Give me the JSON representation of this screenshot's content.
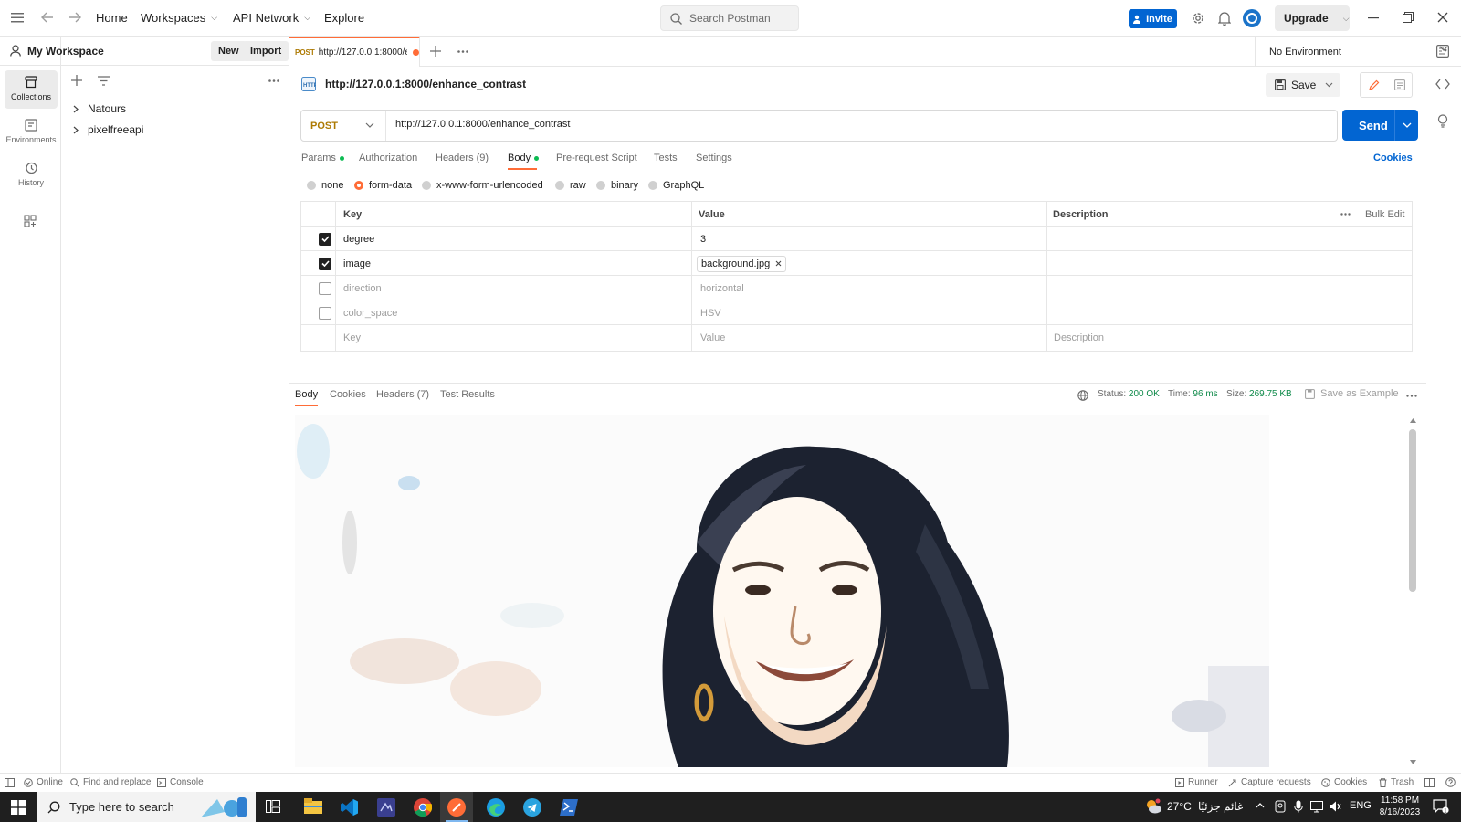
{
  "topbar": {
    "nav": [
      {
        "label": "Home",
        "dropdown": false
      },
      {
        "label": "Workspaces",
        "dropdown": true
      },
      {
        "label": "API Network",
        "dropdown": true
      },
      {
        "label": "Explore",
        "dropdown": false
      }
    ],
    "search_placeholder": "Search Postman",
    "invite_label": "Invite",
    "upgrade_label": "Upgrade"
  },
  "rail": {
    "items": [
      {
        "label": "Collections",
        "icon": "collections-icon",
        "active": true
      },
      {
        "label": "Environments",
        "icon": "environments-icon",
        "active": false
      },
      {
        "label": "History",
        "icon": "history-icon",
        "active": false
      }
    ]
  },
  "sidebar": {
    "workspace_name": "My Workspace",
    "new_label": "New",
    "import_label": "Import",
    "collections": [
      "Natours",
      "pixelfreeapi"
    ]
  },
  "tabs": {
    "active": {
      "method": "POST",
      "title": "http://127.0.0.1:8000/e",
      "unsaved": true
    },
    "environment": "No Environment"
  },
  "request": {
    "title": "http://127.0.0.1:8000/enhance_contrast",
    "save_label": "Save",
    "method": "POST",
    "url": "http://127.0.0.1:8000/enhance_contrast",
    "send_label": "Send",
    "cookies_label": "Cookies",
    "tabs": [
      {
        "label": "Params",
        "dot": true
      },
      {
        "label": "Authorization",
        "dot": false
      },
      {
        "label": "Headers (9)",
        "dot": false
      },
      {
        "label": "Body",
        "dot": true,
        "active": true
      },
      {
        "label": "Pre-request Script",
        "dot": false
      },
      {
        "label": "Tests",
        "dot": false
      },
      {
        "label": "Settings",
        "dot": false
      }
    ],
    "body_types": [
      "none",
      "form-data",
      "x-www-form-urlencoded",
      "raw",
      "binary",
      "GraphQL"
    ],
    "body_type_selected": "form-data"
  },
  "form_table": {
    "headers": {
      "key": "Key",
      "value": "Value",
      "description": "Description",
      "bulk_edit": "Bulk Edit"
    },
    "rows": [
      {
        "key": "degree",
        "value": "3",
        "checked": true,
        "file": false
      },
      {
        "key": "image",
        "value": "background.jpg",
        "checked": true,
        "file": true
      },
      {
        "key": "direction",
        "value": "horizontal",
        "checked": false,
        "file": false
      },
      {
        "key": "color_space",
        "value": "HSV",
        "checked": false,
        "file": false
      }
    ],
    "placeholder": {
      "key": "Key",
      "value": "Value",
      "description": "Description"
    }
  },
  "response": {
    "tabs": [
      "Body",
      "Cookies",
      "Headers (7)",
      "Test Results"
    ],
    "status_label": "Status:",
    "status_value": "200 OK",
    "time_label": "Time:",
    "time_value": "96 ms",
    "size_label": "Size:",
    "size_value": "269.75 KB",
    "save_example": "Save as Example"
  },
  "footer": {
    "online": "Online",
    "find_replace": "Find and replace",
    "console": "Console",
    "runner": "Runner",
    "capture": "Capture requests",
    "cookies": "Cookies",
    "trash": "Trash"
  },
  "taskbar": {
    "search_placeholder": "Type here to search",
    "weather": "27°C",
    "weather_text": "غائم جزئيًا",
    "language": "ENG",
    "time": "11:58 PM",
    "date": "8/16/2023"
  },
  "colors": {
    "accent": "#ff6c37",
    "primary_blue": "#0265d2",
    "success": "#0f8a4a",
    "method_post": "#ad7a03"
  }
}
